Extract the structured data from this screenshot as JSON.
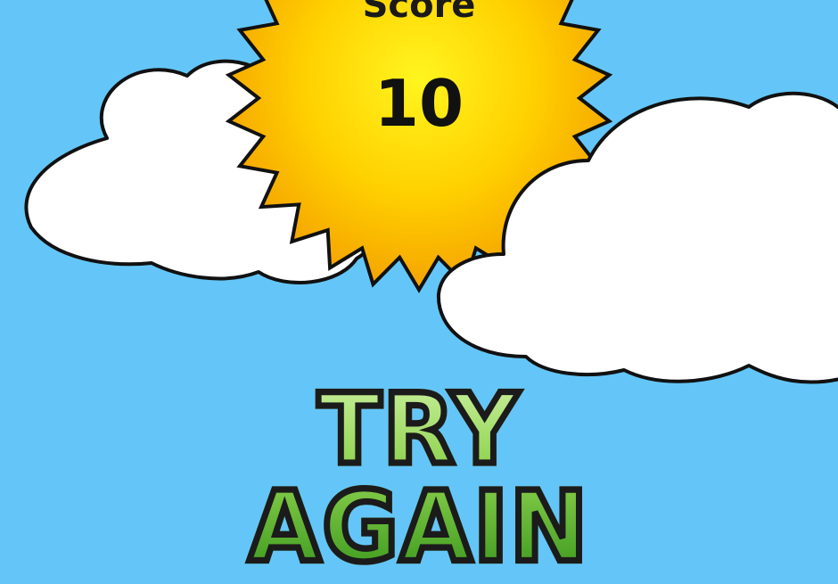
{
  "score": {
    "label": "Score",
    "value": "10"
  },
  "buttons": {
    "try_again_label": "TRY AGAIN"
  },
  "colors": {
    "sky": "#64c6f8",
    "sun_center": "#fff21a",
    "sun_edge": "#f5a300",
    "cloud": "#ffffff",
    "outline": "#111111",
    "button_light": "#c8ef9a",
    "button_dark": "#3c9a1e"
  },
  "icons": [
    "sun-icon",
    "cloud-icon"
  ]
}
